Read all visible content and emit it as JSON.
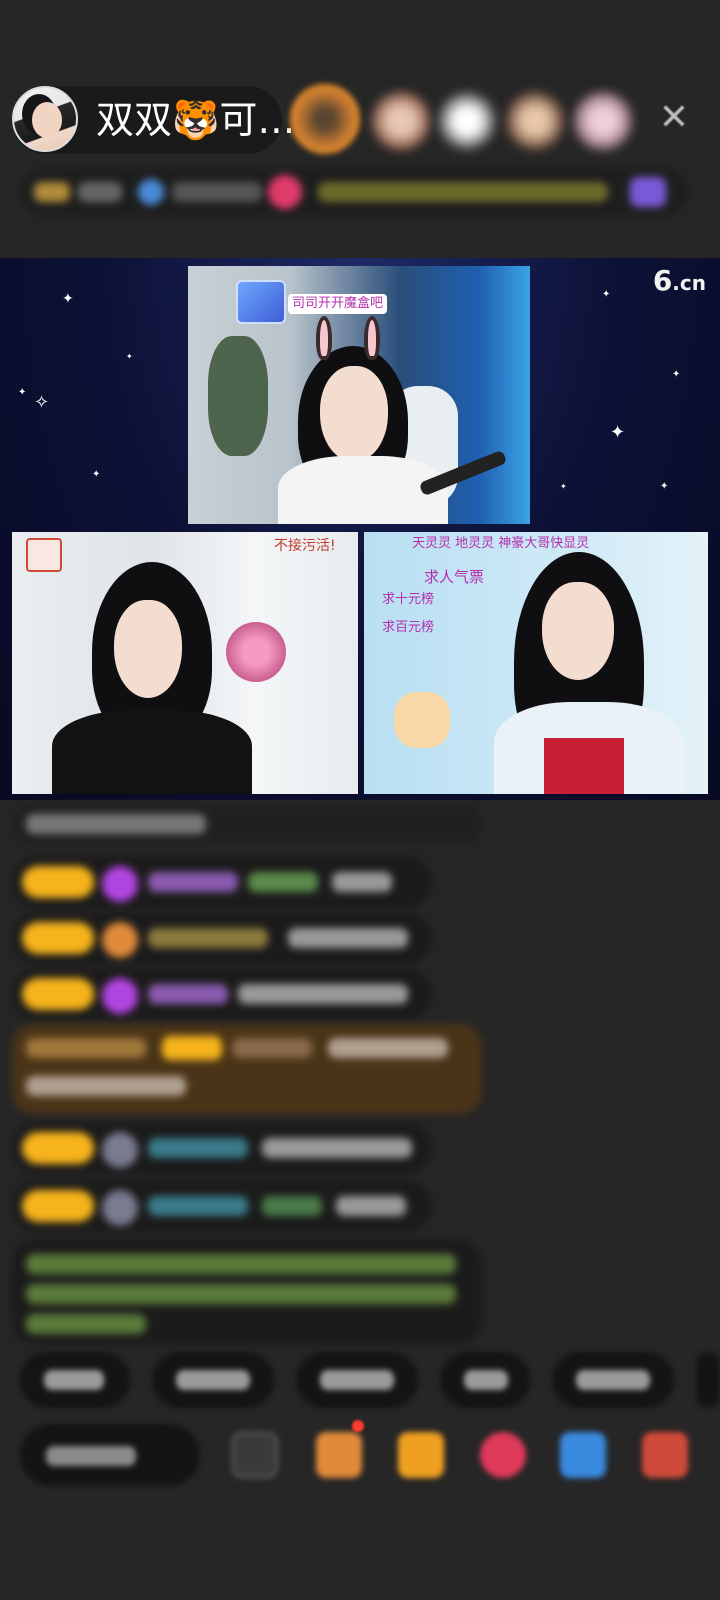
{
  "header": {
    "host_name": "双双🐯可…",
    "close_icon": "close-icon"
  },
  "video": {
    "logo_main": "6",
    "logo_suffix": ".cn",
    "main_sticker_text": "司司开开魔盒吧",
    "left_caption": "不接污活!",
    "right_top_text": "天灵灵 地灵灵 神豪大哥快显灵",
    "right_tag_1": "求人气票",
    "right_tag_2": "求十元榜",
    "right_tag_3": "求百元榜"
  },
  "colors": {
    "accent_gold": "#f6b31b",
    "pink_text": "#b42fb0",
    "background": "#262626"
  }
}
